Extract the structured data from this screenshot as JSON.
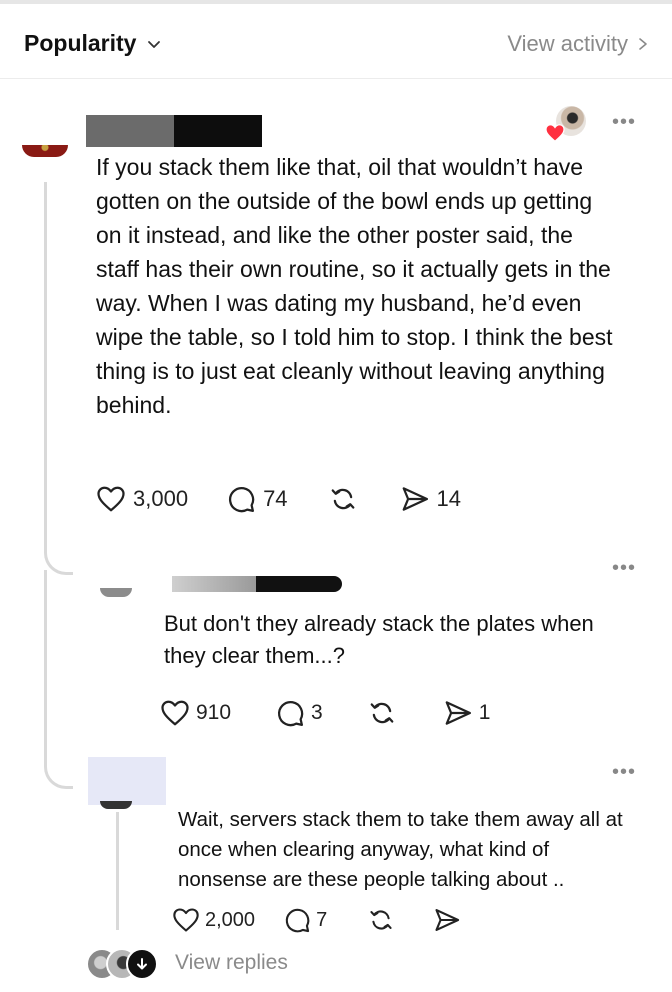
{
  "header": {
    "sort_label": "Popularity",
    "activity_label": "View activity"
  },
  "comments": [
    {
      "text": "If you stack them like that, oil that wouldn’t have gotten on the outside of the bowl ends up getting on it instead, and like the other poster said, the staff has their own routine, so it actually gets in the way. When I was dating my husband, he’d even wipe the table, so I told him to stop. I think the best thing is to just eat cleanly without leaving anything behind.",
      "likes": "3,000",
      "replies": "74",
      "shares": "14"
    },
    {
      "text": "But don't they already stack the plates when they clear them...?",
      "likes": "910",
      "replies": "3",
      "shares": "1"
    },
    {
      "text": "Wait, servers stack them to take them away all at once when clearing anyway, what kind of nonsense are these people talking about ..",
      "likes": "2,000",
      "replies": "7"
    }
  ],
  "footer": {
    "view_replies_label": "View replies"
  },
  "icons": [
    "chevron-down-icon",
    "chevron-right-icon",
    "more-icon",
    "heart-icon",
    "comment-icon",
    "repost-icon",
    "share-icon",
    "arrow-down-icon"
  ],
  "colors": {
    "secondary_text": "#8a8a8a",
    "thread_line": "#d9d9d9",
    "like_badge": "#ff3040"
  }
}
